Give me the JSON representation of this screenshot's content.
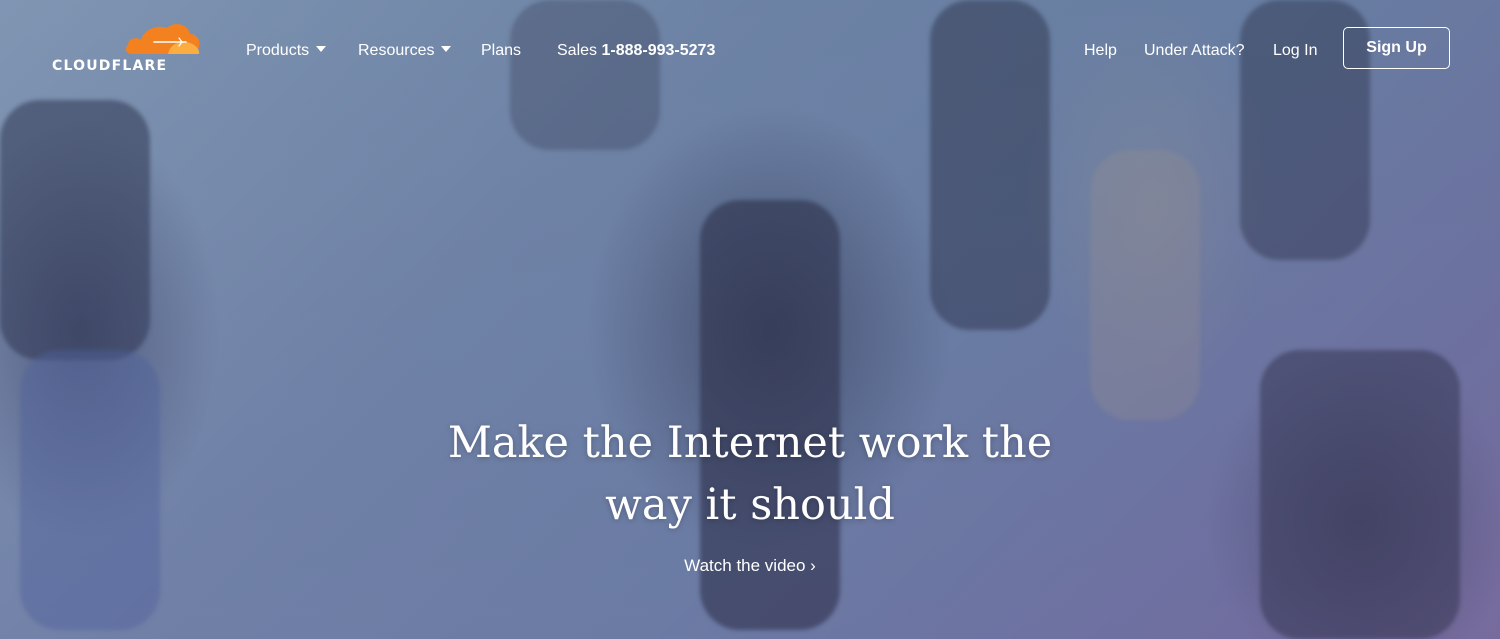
{
  "brand": {
    "name": "CLOUDFLARE",
    "logo_color": "#f48120"
  },
  "nav": {
    "products": "Products",
    "resources": "Resources",
    "plans": "Plans",
    "sales_label": "Sales",
    "sales_phone": "1-888-993-5273",
    "help": "Help",
    "under_attack": "Under Attack?",
    "login": "Log In",
    "signup": "Sign Up"
  },
  "hero": {
    "headline_line1": "Make the Internet work the",
    "headline_line2": "way it should",
    "cta": "Watch the video ›"
  },
  "icons": {
    "logo": "cloud-icon",
    "dropdown": "caret-down-icon"
  }
}
